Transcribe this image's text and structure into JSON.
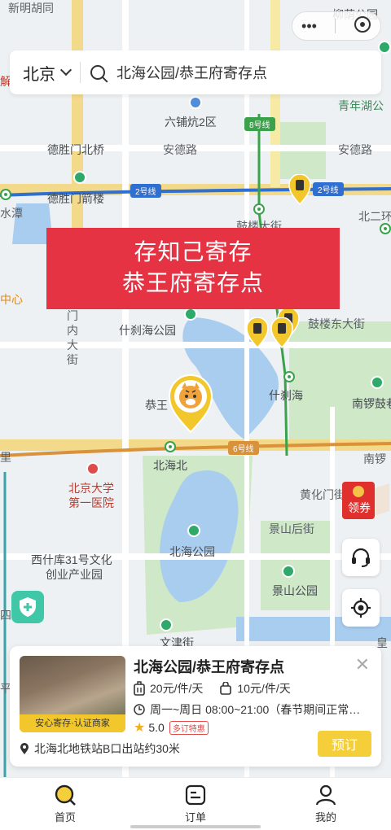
{
  "capsule": {
    "more_icon": "ellipsis-icon",
    "close_icon": "target-circle-icon"
  },
  "search": {
    "city": "北京",
    "placeholder": "北海公园/恭王府寄存点"
  },
  "banner": {
    "line1": "存知己寄存",
    "line2": "恭王府寄存点"
  },
  "map_labels": {
    "xinmingutong": "新明胡同",
    "liuyin": "柳荫公园",
    "liupukang": "六铺炕2区",
    "jiehospital": "解医院",
    "deshengmen_bridge": "德胜门北桥",
    "andinglu1": "安德路",
    "andinglu2": "安德路",
    "qingnianhu": "青年湖公",
    "deshengmen_tower": "德胜门箭楼",
    "shuitan": "水潭",
    "beierhuan": "北二环",
    "gulou": "鼓楼大街",
    "zhongxin": "中心",
    "mennei1": "门",
    "mennei2": "内",
    "mennei3": "大",
    "mennei4": "街",
    "shichahai_park": "什刹海公园",
    "gulou_east": "鼓楼东大街",
    "shichahai": "什刹海",
    "nanluogu": "南锣鼓巷",
    "gongwang": "恭王",
    "li": "里",
    "beihaibei": "北海北",
    "nanluo2": "南锣",
    "pku1": "北京大学",
    "pku2": "第一医院",
    "huanghuamen": "黄化门街",
    "jingshanhoujie": "景山后街",
    "xishiku1": "西什库31号文化",
    "xishiku2": "创业产业园",
    "beihai_park": "北海公园",
    "jingshan_park": "景山公园",
    "wenjin": "文津街",
    "si": "四",
    "ping": "平",
    "huang": "皇"
  },
  "line_badges": {
    "line8": "8号线",
    "line2a": "2号线",
    "line2b": "2号线",
    "line6": "6号线"
  },
  "store": {
    "name": "北海公园/恭王府寄存点",
    "thumb_badge": "安心寄存·认证商家",
    "price_small": "20元/件/天",
    "price_large": "10元/件/天",
    "hours": "周一~周日 08:00~21:00（春节期间正常…",
    "rating": "5.0",
    "rating_tag": "多订特惠",
    "address": "北海北地铁站B口出站约30米",
    "book_label": "预订"
  },
  "coupon_label": "领券",
  "nav": [
    {
      "label": "首页",
      "icon": "search-home-icon"
    },
    {
      "label": "订单",
      "icon": "order-icon"
    },
    {
      "label": "我的",
      "icon": "profile-icon"
    }
  ],
  "colors": {
    "accent": "#f5cf3a",
    "banner": "#e53344",
    "metro2": "#2f6fd1",
    "metro6": "#d9913a",
    "metro8": "#3aa24a"
  }
}
